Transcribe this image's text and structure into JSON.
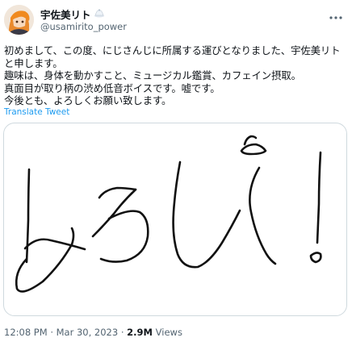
{
  "author": {
    "display_name": "宇佐美リト",
    "handle": "@usamirito_power"
  },
  "tweet": {
    "text": "初めまして、この度、にじさんじに所属する運びとなりました、宇佐美リトと申します。\n趣味は、身体を動かすこと、ミュージカル鑑賞、カフェイン摂取。\n真面目が取り柄の渋め低音ボイスです。嘘です。\n今後とも、よろしくお願い致します。",
    "translate_label": "Translate Tweet",
    "image_handwriting": "よろしく！"
  },
  "meta": {
    "time": "12:08 PM",
    "separator": "·",
    "date": "Mar 30, 2023",
    "views_count": "2.9M",
    "views_label": "Views"
  },
  "icons": {
    "more": "more-options-icon",
    "cap": "cap-emoji-icon"
  },
  "colors": {
    "link": "#1d9bf0",
    "muted": "#536471",
    "text": "#0f1419",
    "border": "#cfd9de"
  }
}
